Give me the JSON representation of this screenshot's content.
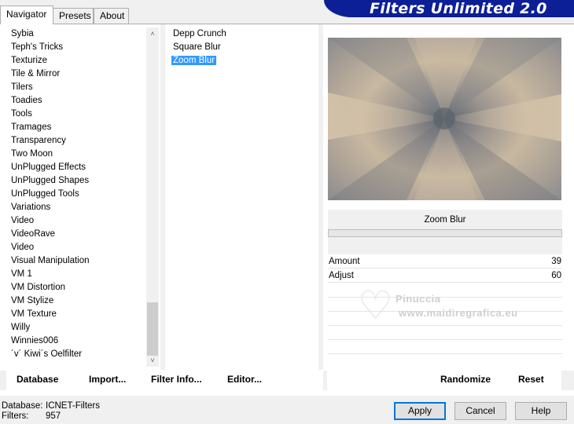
{
  "tabs": [
    {
      "label": "Navigator",
      "active": true
    },
    {
      "label": "Presets",
      "active": false
    },
    {
      "label": "About",
      "active": false
    }
  ],
  "banner": {
    "title": "Filters Unlimited 2.0"
  },
  "categories": [
    "Sybia",
    "Teph's Tricks",
    "Texturize",
    "Tile & Mirror",
    "Tilers",
    "Toadies",
    "Tools",
    "Tramages",
    "Transparency",
    "Two Moon",
    "UnPlugged Effects",
    "UnPlugged Shapes",
    "UnPlugged Tools",
    "Variations",
    "Video",
    "VideoRave",
    "Video",
    "Visual Manipulation",
    "VM 1",
    "VM Distortion",
    "VM Stylize",
    "VM Texture",
    "Willy",
    "Winnies006",
    "´v´ Kiwi´s Oelfilter"
  ],
  "filters": [
    {
      "label": "Depp Crunch",
      "selected": false
    },
    {
      "label": "Square Blur",
      "selected": false
    },
    {
      "label": "Zoom Blur",
      "selected": true
    }
  ],
  "filter_name": "Zoom Blur",
  "params": [
    {
      "label": "Amount",
      "value": "39"
    },
    {
      "label": "Adjust",
      "value": "60"
    }
  ],
  "watermark": {
    "line1": "Pinuccia",
    "line2": "www.maidiregrafica.eu"
  },
  "links": {
    "database": "Database",
    "import": "Import...",
    "filter_info": "Filter Info...",
    "editor": "Editor...",
    "randomize": "Randomize",
    "reset": "Reset"
  },
  "info": {
    "database_label": "Database:",
    "database_value": "ICNET-Filters",
    "filters_label": "Filters:",
    "filters_value": "957"
  },
  "buttons": {
    "apply": "Apply",
    "cancel": "Cancel",
    "help": "Help"
  },
  "colors": {
    "banner": "#0c1f96",
    "selection": "#3399ff",
    "preview_tone": "#b8a996"
  },
  "icons": {
    "scroll_up": "˄",
    "scroll_down": "˅",
    "watermark": "heart-icon"
  }
}
